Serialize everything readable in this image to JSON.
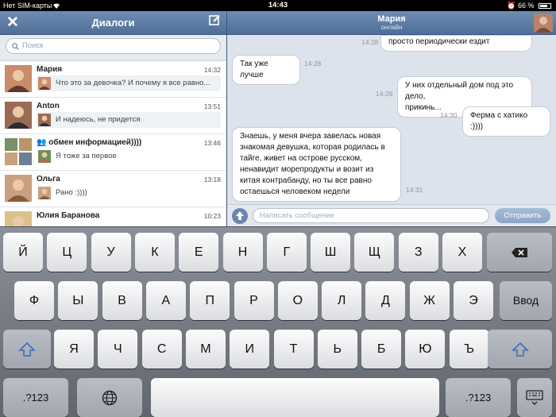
{
  "status": {
    "carrier": "Нет SIM-карты",
    "time": "14:43",
    "battery": "66 %",
    "battery_level": 0.66
  },
  "left": {
    "title": "Диалоги",
    "search_placeholder": "Поиск",
    "dialogs": [
      {
        "name": "Мария",
        "time": "14:32",
        "snippet": "Что это за девочка? И почему я все равно...",
        "unread": true
      },
      {
        "name": "Anton",
        "time": "13:51",
        "snippet": "И надеюсь, не придется",
        "unread": true
      },
      {
        "name": "обмен информацией))))",
        "time": "13:46",
        "snippet": "Я тоже за первое",
        "unread": false
      },
      {
        "name": "Ольга",
        "time": "13:18",
        "snippet": "Рано :))))",
        "unread": false
      },
      {
        "name": "Юлия Баранова",
        "time": "10:23",
        "snippet": "",
        "unread": false
      }
    ]
  },
  "chat": {
    "name": "Мария",
    "status": "онлайн",
    "messages": [
      {
        "dir": "out",
        "lines": [
          "просто периодически ездит"
        ],
        "time": "14:28"
      },
      {
        "dir": "in",
        "lines": [
          "Так уже лучше"
        ],
        "time": "14:28"
      },
      {
        "dir": "out",
        "lines": [
          "У них отдельный дом под это дело,",
          "прикинь..."
        ],
        "time": "14:29"
      },
      {
        "dir": "out",
        "lines": [
          "Ферма с хатико :))))"
        ],
        "time": "14:30"
      },
      {
        "dir": "in",
        "lines": [
          "Знаешь, у меня вчера завелась новая",
          "знакомая девушка, которая родилась в",
          "тайге, живет на острове русском,",
          "ненавидит морепродукты и возит из",
          "китая контрабанду, но ты все равно",
          "остаешься человеком недели"
        ],
        "time": "14:31"
      }
    ],
    "input_placeholder": "Написать сообщение",
    "send_label": "Отправить"
  },
  "keyboard": {
    "row1": [
      "Й",
      "Ц",
      "У",
      "К",
      "Е",
      "Н",
      "Г",
      "Ш",
      "Щ",
      "З",
      "Х"
    ],
    "row2": [
      "Ф",
      "Ы",
      "В",
      "А",
      "П",
      "Р",
      "О",
      "Л",
      "Д",
      "Ж",
      "Э"
    ],
    "row3": [
      "Я",
      "Ч",
      "С",
      "М",
      "И",
      "Т",
      "Ь",
      "Б",
      "Ю",
      "Ъ"
    ],
    "enter_label": "Ввод",
    "numbers_label": ".?123",
    "icons": {
      "shift": "shift-icon",
      "backspace": "backspace-icon",
      "globe": "globe-icon",
      "hide": "keyboard-hide-icon"
    }
  },
  "colors": {
    "header": "#5a79a3",
    "accent": "#4f6e97",
    "send": "#8ca6c8"
  }
}
